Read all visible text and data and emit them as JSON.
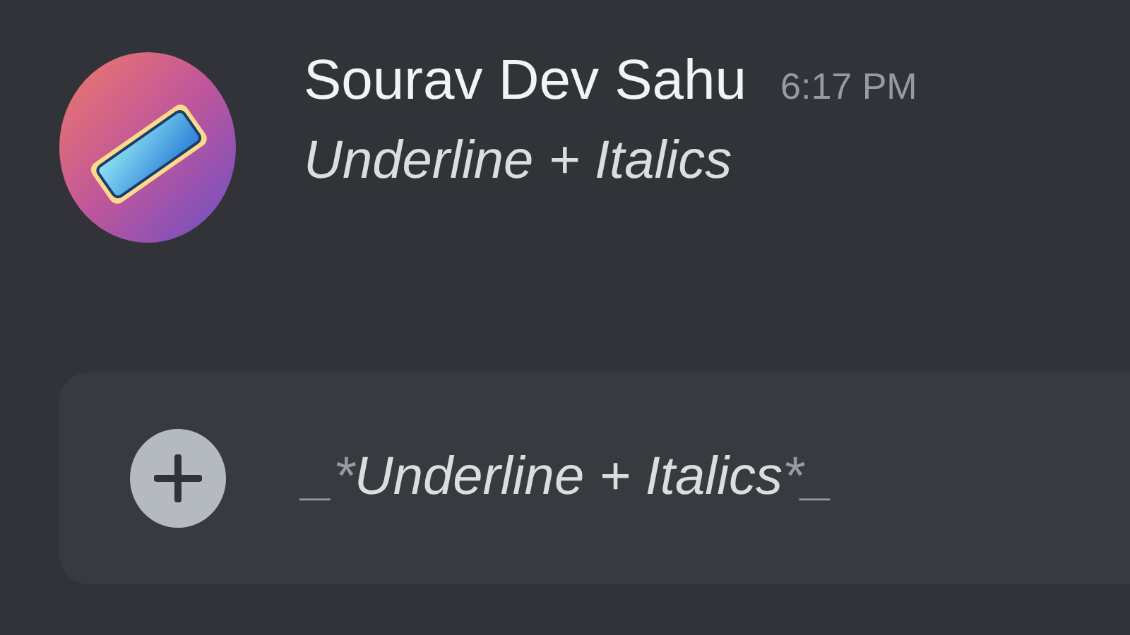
{
  "message": {
    "author": "Sourav Dev Sahu",
    "time": "6:17 PM",
    "text": "Underline + Italics"
  },
  "composer": {
    "segments": [
      {
        "text": "_*",
        "kind": "syntax"
      },
      {
        "text": "Underline + Italics",
        "kind": "content"
      },
      {
        "text": "*_",
        "kind": "syntax"
      }
    ]
  }
}
